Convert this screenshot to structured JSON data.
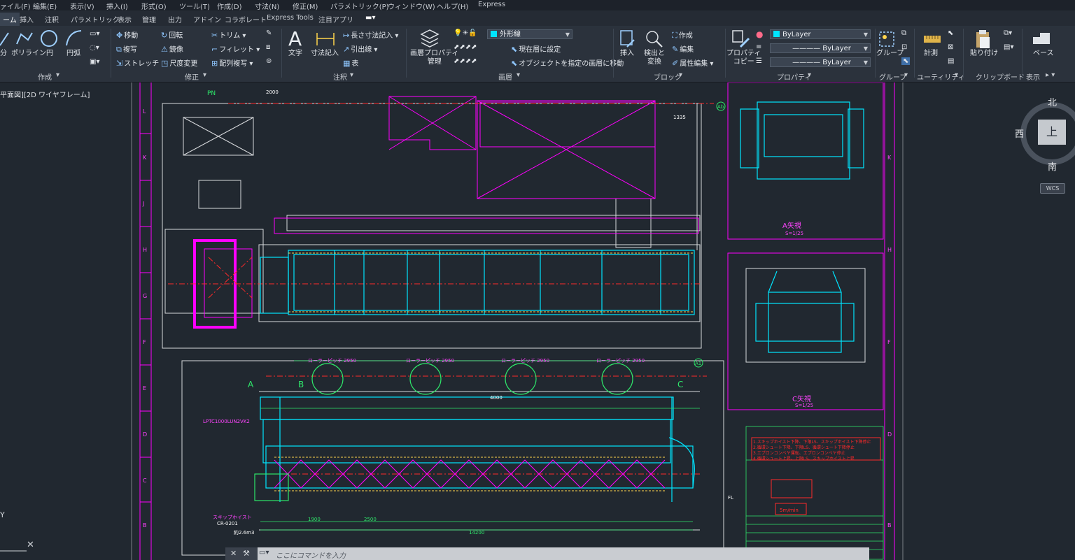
{
  "menu": {
    "items": [
      "ァイル(F)",
      "編集(E)",
      "表示(V)",
      "挿入(I)",
      "形式(O)",
      "ツール(T)",
      "作成(D)",
      "寸法(N)",
      "修正(M)",
      "パラメトリック(P)",
      "ウィンドウ(W)",
      "ヘルプ(H)",
      "Express"
    ]
  },
  "tabs": {
    "active": "ーム",
    "items": [
      "挿入",
      "注釈",
      "パラメトリック",
      "表示",
      "管理",
      "出力",
      "アドイン",
      "コラボレート",
      "Express Tools",
      "注目アプリ"
    ]
  },
  "ribbon": {
    "draw": {
      "title": "作成",
      "polyline": "ポリライン",
      "circle": "円",
      "arc": "円弧",
      "line_partial": "分"
    },
    "modify": {
      "title": "修正",
      "move": "移動",
      "rotate": "回転",
      "trim": "トリム",
      "copy": "複写",
      "mirror": "鏡像",
      "fillet": "フィレット",
      "stretch": "ストレッチ",
      "scale": "尺度変更",
      "array": "配列複写"
    },
    "annotation": {
      "title": "注釈",
      "text": "文字",
      "dimension": "寸法記入",
      "linear": "長さ寸法記入",
      "leader": "引出線",
      "table": "表"
    },
    "layers": {
      "title": "画層",
      "properties": "画層プロパティ\n管理",
      "current_layer": "外形線",
      "make_current": "現在層に設定",
      "move_to_layer": "オブジェクトを指定の画層に移動"
    },
    "block": {
      "title": "ブロック",
      "insert": "挿入",
      "find_replace": "検出と\n変換",
      "create": "作成",
      "edit": "編集",
      "attr_edit": "属性編集"
    },
    "properties": {
      "title": "プロパティ",
      "match": "プロパティ\nコピー",
      "color": "ByLayer",
      "linetype": "ByLayer",
      "lineweight": "ByLayer"
    },
    "groups": {
      "title": "グループ",
      "group": "グループ"
    },
    "utilities": {
      "title": "ユーティリティ",
      "measure": "計測"
    },
    "clipboard": {
      "title": "クリップボード",
      "paste": "貼り付け"
    },
    "view": {
      "title": "表示",
      "base": "ベース"
    }
  },
  "viewport": {
    "label": "平面図][2D ワイヤフレーム]"
  },
  "viewcube": {
    "north": "北",
    "south": "南",
    "west": "西",
    "top": "上",
    "wcs": "WCS"
  },
  "command": {
    "placeholder": "ここにコマンドを入力"
  },
  "drawing": {
    "rows": [
      "L",
      "K",
      "J",
      "H",
      "G",
      "F",
      "E",
      "D",
      "C",
      "B"
    ],
    "labels": {
      "a_view": "A矢視",
      "a_scale": "S=1/25",
      "c_view": "C矢視",
      "c_scale": "S=1/25",
      "total_length": "14200",
      "dim_2950": "ローラーピッチ 2950",
      "lptc": "LPTC1000LUN2VK2",
      "dim_1900": "1900",
      "dim_2500": "2500",
      "dim_2000": "2000",
      "mark_a": "A",
      "mark_b": "B",
      "mark_c": "C",
      "mark_a1": "A1",
      "mark_ab": "Ab",
      "mark_pn": "PN",
      "dim_1335": "1335",
      "dim_4000": "4000",
      "notes_1": "1.スキップホイスト下降、下限LS、スキップホイスト下降停止",
      "notes_2": "2.循環シュート下降、下限LS、循環シュート下降停止",
      "notes_3": "3.エプロンコンベヤ運転、エプロンコンベヤ停止",
      "notes_4": "4.循環シュート上昇、上限LS、スキップホイスト上昇",
      "speed": "5m/min",
      "skip": "スキップホイスト",
      "cr": "CR-0201",
      "vol": "約2.6m3",
      "fl": "FL"
    }
  }
}
